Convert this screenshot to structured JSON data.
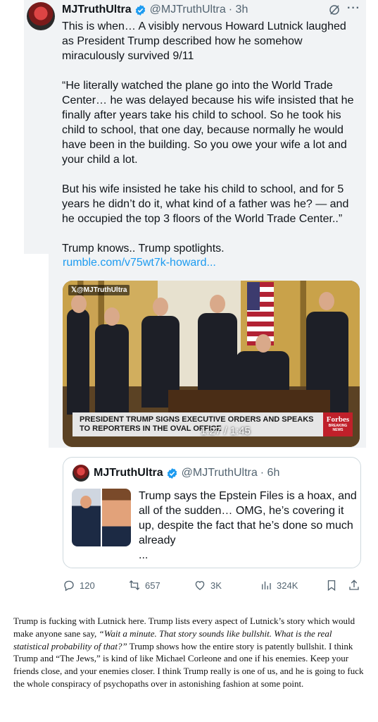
{
  "tweet": {
    "display_name": "MJTruthUltra",
    "handle": "@MJTruthUltra",
    "time": "· 3h",
    "more_icon": "···",
    "paragraphs": [
      "This is when… A visibly nervous Howard Lutnick laughed as President Trump described how he somehow miraculously survived 9/11",
      "“He literally watched the plane go into the World Trade Center… he was delayed because his wife insisted that he finally after years take his child to school. So he took his child to school, that one day, because normally he would have been in the building. So you owe your wife a lot and your child a lot.",
      "But his wife insisted he take his child to school, and for 5 years he didn’t do it, what kind of a father was he? — and he occupied the top 3 floors of the World Trade Center..”",
      "Trump knows.. Trump spotlights."
    ],
    "link": "rumble.com/v75wt7k-howard..."
  },
  "video": {
    "watermark": "𝕏@MJTruthUltra",
    "chyron_line1": "PRESIDENT TRUMP SIGNS EXECUTIVE ORDERS AND SPEAKS",
    "chyron_line2": "TO REPORTERS IN THE OVAL OFFICE",
    "brand": "Forbes",
    "brand_sub": "BREAKING NEWS",
    "timer": "1:27 / 1:45"
  },
  "quote": {
    "display_name": "MJTruthUltra",
    "handle": "@MJTruthUltra",
    "time": "· 6h",
    "text": "Trump says the Epstein Files is a hoax, and all of the sudden… OMG, he’s covering it up, despite the fact that he’s done so much already",
    "ellipsis": "..."
  },
  "actions": {
    "replies": "120",
    "reposts": "657",
    "likes": "3K",
    "views": "324K"
  },
  "article": {
    "part1": "Trump is fucking with Lutnick here. Trump lists every aspect of Lutnick’s story which would make anyone sane say, ",
    "quote": "“Wait a minute. That story sounds like bullshit. What is the real statistical probability of that?”",
    "part2": " Trump shows how the entire story is patently bullshit. I think Trump and “The Jews,” is kind of like Michael Corleone and one if his enemies. Keep your friends close, and your enemies closer. I think Trump really is one of us, and he is going to fuck the whole conspiracy of psychopaths over in astonishing fashion at some point."
  },
  "colors": {
    "highlight_bg": "#f1f3f5",
    "link": "#1d9bf0",
    "verified": "#1d9bf0",
    "muted": "#536471"
  }
}
